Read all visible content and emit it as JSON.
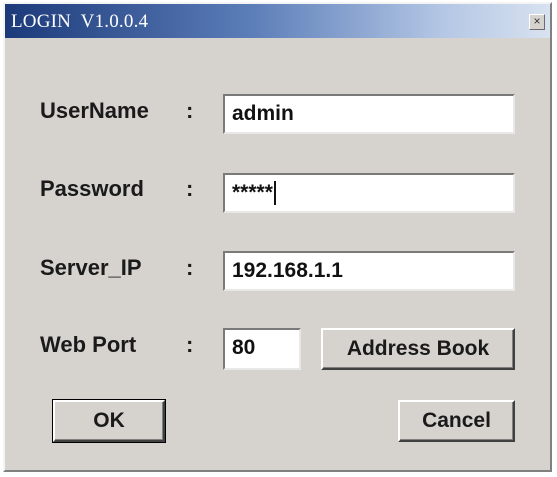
{
  "window": {
    "title": "LOGIN  V1.0.0.4",
    "close_symbol": "×"
  },
  "form": {
    "username": {
      "label": "UserName",
      "colon": ":",
      "value": "admin"
    },
    "password": {
      "label": "Password",
      "colon": ":",
      "value": "*****"
    },
    "server_ip": {
      "label": "Server_IP",
      "colon": ":",
      "value": "192.168.1.1"
    },
    "web_port": {
      "label": "Web Port",
      "colon": ":",
      "value": "80"
    }
  },
  "buttons": {
    "address_book": "Address Book",
    "ok": "OK",
    "cancel": "Cancel"
  }
}
